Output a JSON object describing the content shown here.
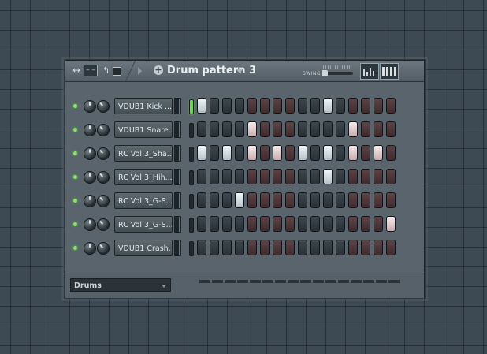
{
  "titlebar": {
    "pattern_name": "Drum pattern 3",
    "swing_label": "SWING",
    "swing_value": 0.0
  },
  "colors": {
    "led_on": "#8be26d",
    "step_dark": "#343d43",
    "step_red": "#4e3639",
    "step_on": "#e6ecef"
  },
  "icons": [
    "arrows-icon",
    "grid-icon",
    "undo-icon",
    "snap-icon",
    "play-icon",
    "add-pattern-icon",
    "graph-editor-icon",
    "piano-roll-icon"
  ],
  "channels": [
    {
      "name": "VDUB1 Kick ...",
      "selected": true,
      "steps": [
        1,
        0,
        0,
        0,
        0,
        0,
        0,
        0,
        0,
        0,
        1,
        0,
        0,
        0,
        0,
        0
      ]
    },
    {
      "name": "VDUB1 Snare...",
      "selected": false,
      "steps": [
        0,
        0,
        0,
        0,
        1,
        0,
        0,
        0,
        0,
        0,
        0,
        0,
        1,
        0,
        0,
        0
      ]
    },
    {
      "name": "RC Vol.3_Sha...",
      "selected": false,
      "steps": [
        1,
        0,
        1,
        0,
        1,
        0,
        1,
        0,
        1,
        0,
        1,
        0,
        1,
        0,
        1,
        0
      ]
    },
    {
      "name": "RC Vol.3_Hih...",
      "selected": false,
      "steps": [
        0,
        0,
        0,
        0,
        0,
        0,
        0,
        0,
        0,
        0,
        1,
        0,
        0,
        0,
        0,
        0
      ]
    },
    {
      "name": "RC Vol.3_G-S...",
      "selected": false,
      "steps": [
        0,
        0,
        0,
        1,
        0,
        0,
        0,
        0,
        0,
        0,
        0,
        0,
        0,
        0,
        0,
        0
      ]
    },
    {
      "name": "RC Vol.3_G-S...",
      "selected": false,
      "steps": [
        0,
        0,
        0,
        0,
        0,
        0,
        0,
        0,
        0,
        0,
        0,
        0,
        0,
        0,
        0,
        1
      ]
    },
    {
      "name": "VDUB1 Crash...",
      "selected": false,
      "steps": [
        0,
        0,
        0,
        0,
        0,
        0,
        0,
        0,
        0,
        0,
        0,
        0,
        0,
        0,
        0,
        0
      ]
    }
  ],
  "footer": {
    "filter_value": "Drums"
  }
}
